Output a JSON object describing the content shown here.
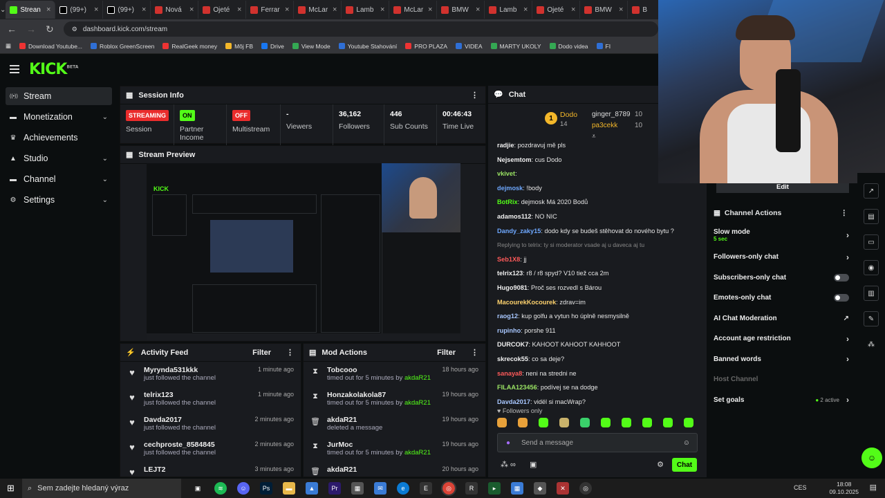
{
  "browser": {
    "tabs": [
      "Strean",
      "(99+)",
      "(99+)",
      "Nová",
      "Ojeté",
      "Ferrar",
      "McLar",
      "Lamb",
      "McLar",
      "BMW",
      "Lamb",
      "Ojeté",
      "BMW",
      "B"
    ],
    "url": "dashboard.kick.com/stream",
    "bookmarks": [
      "Download Youtube...",
      "Roblox GreenScreen",
      "RealGeek money",
      "Môj FB",
      "Drive",
      "View Mode",
      "Youtube Stahování",
      "PRO PLAZA",
      "VIDEA",
      "MARTY UKOLY",
      "Dodo videa",
      "FI"
    ]
  },
  "kick": {
    "logo": "KICK",
    "logo_tag": "BETA",
    "sidebar": [
      {
        "label": "Stream",
        "icon": "broadcast-icon",
        "chev": false,
        "selected": true
      },
      {
        "label": "Monetization",
        "icon": "money-icon",
        "chev": true
      },
      {
        "label": "Achievements",
        "icon": "trophy-icon",
        "chev": false
      },
      {
        "label": "Studio",
        "icon": "studio-icon",
        "chev": true
      },
      {
        "label": "Channel",
        "icon": "channel-icon",
        "chev": true
      },
      {
        "label": "Settings",
        "icon": "gear-icon",
        "chev": true
      }
    ],
    "session": {
      "title": "Session Info",
      "streaming_badge": "STREAMING",
      "session_label": "Session",
      "partner_badge": "ON",
      "partner_label": "Partner Income",
      "multistream_badge": "OFF",
      "multistream_label": "Multistream",
      "viewers_val": "-",
      "viewers_label": "Viewers",
      "followers_val": "36,162",
      "followers_label": "Followers",
      "subs_val": "446",
      "subs_label": "Sub Counts",
      "time_val": "00:46:43",
      "time_label": "Time Live"
    },
    "preview_title": "Stream Preview",
    "activity": {
      "title": "Activity Feed",
      "filter": "Filter",
      "items": [
        {
          "name": "Myrynda531kkk",
          "sub": "just followed the channel",
          "time": "1 minute ago"
        },
        {
          "name": "telrix123",
          "sub": "just followed the channel",
          "time": "1 minute ago"
        },
        {
          "name": "Davda2017",
          "sub": "just followed the channel",
          "time": "2 minutes ago"
        },
        {
          "name": "cechproste_8584845",
          "sub": "just followed the channel",
          "time": "2 minutes ago"
        },
        {
          "name": "LEJT2",
          "sub": "",
          "time": "3 minutes ago"
        }
      ]
    },
    "mod": {
      "title": "Mod Actions",
      "filter": "Filter",
      "items": [
        {
          "icon": "hourglass-icon",
          "glyph": "⧗",
          "name": "Tobcooo",
          "sub": "timed out for 5 minutes by",
          "by": "akdaR21",
          "time": "18 hours ago"
        },
        {
          "icon": "hourglass-icon",
          "glyph": "⧗",
          "name": "Honzakolakola87",
          "sub": "timed out for 5 minutes by",
          "by": "akdaR21",
          "time": "19 hours ago"
        },
        {
          "icon": "trash-icon",
          "glyph": "🗑",
          "name": "akdaR21",
          "sub": "deleted a message",
          "by": "",
          "time": "19 hours ago"
        },
        {
          "icon": "hourglass-icon",
          "glyph": "⧗",
          "name": "JurMoc",
          "sub": "timed out for 5 minutes by",
          "by": "akdaR21",
          "time": "19 hours ago"
        },
        {
          "icon": "trash-icon",
          "glyph": "🗑",
          "name": "akdaR21",
          "sub": "",
          "by": "",
          "time": "20 hours ago"
        }
      ]
    },
    "chat": {
      "title": "Chat",
      "top1": "Dodo",
      "top1_num": "14",
      "top2": "ginger_8789",
      "top2_num": "10",
      "top3": "pa3cekk",
      "top3_num": "10",
      "messages": [
        {
          "user": "radjie",
          "color": "#f0f0f0",
          "text": "pozdravuj mě pls"
        },
        {
          "user": "Nejsemtom",
          "color": "#f0f0f0",
          "text": "cus Dodo"
        },
        {
          "user": "vkivet",
          "color": "#9be564",
          "text": ""
        },
        {
          "user": "dejmosk",
          "color": "#6ea8ff",
          "text": "!body"
        },
        {
          "user": "BotRix",
          "color": "#53fc18",
          "text": "dejmosk Má 2020 Bodů"
        },
        {
          "user": "adamos112",
          "color": "#f0f0f0",
          "text": "NO NIC"
        },
        {
          "user": "Dandy_zaky15",
          "color": "#6ea8ff",
          "text": "dodo kdy se budeš stěhovat do nového bytu ?"
        },
        {
          "user": "",
          "color": "#888",
          "text": "Replying to telrix: ty si moderator vsade aj u daveca aj tu"
        },
        {
          "user": "Seb1X8",
          "color": "#ff5a5a",
          "text": "jj"
        },
        {
          "user": "telrix123",
          "color": "#f0f0f0",
          "text": "r8 / r8 spyd? V10 tiež cca 2m"
        },
        {
          "user": "Hugo9081",
          "color": "#f0f0f0",
          "text": "Proč ses rozvedl s Bárou"
        },
        {
          "user": "MacourekKocourek",
          "color": "#ffd36e",
          "text": "zdrav=im"
        },
        {
          "user": "raog12",
          "color": "#a8c7ff",
          "text": "kup golfu a vytun ho úplně nesmysilně"
        },
        {
          "user": "rupinho",
          "color": "#a8c7ff",
          "text": "porshe 911"
        },
        {
          "user": "DURCOK7",
          "color": "#f0f0f0",
          "text": "KAHOOT KAHOOT KAHHOOT"
        },
        {
          "user": "skrecok55",
          "color": "#f0f0f0",
          "text": "co sa deje?"
        },
        {
          "user": "sanaya8",
          "color": "#ff5a5a",
          "text": "neni na stredni ne"
        },
        {
          "user": "FILAA123456",
          "color": "#9be564",
          "text": "podívej se na dodge"
        },
        {
          "user": "Davda2017",
          "color": "#a8c7ff",
          "text": "vidël si macWrap?"
        }
      ],
      "followers_only": "Followers only",
      "placeholder": "Send a message",
      "send": "Chat"
    },
    "channel_actions": {
      "edit": "Edit",
      "title": "Channel Actions",
      "slow_mode": "Slow mode",
      "slow_sub": "5 sec",
      "followers_only": "Followers-only chat",
      "subscribers_only": "Subscribers-only chat",
      "emotes_only": "Emotes-only chat",
      "ai_mod": "AI Chat Moderation",
      "account_age": "Account age restriction",
      "banned_words": "Banned words",
      "host_channel": "Host Channel",
      "set_goals": "Set goals",
      "goals_active": "2 active"
    }
  },
  "taskbar": {
    "search": "Sem zadejte hledaný výraz",
    "lang": "CES",
    "time": "18:08",
    "date": "09.10.2025"
  }
}
